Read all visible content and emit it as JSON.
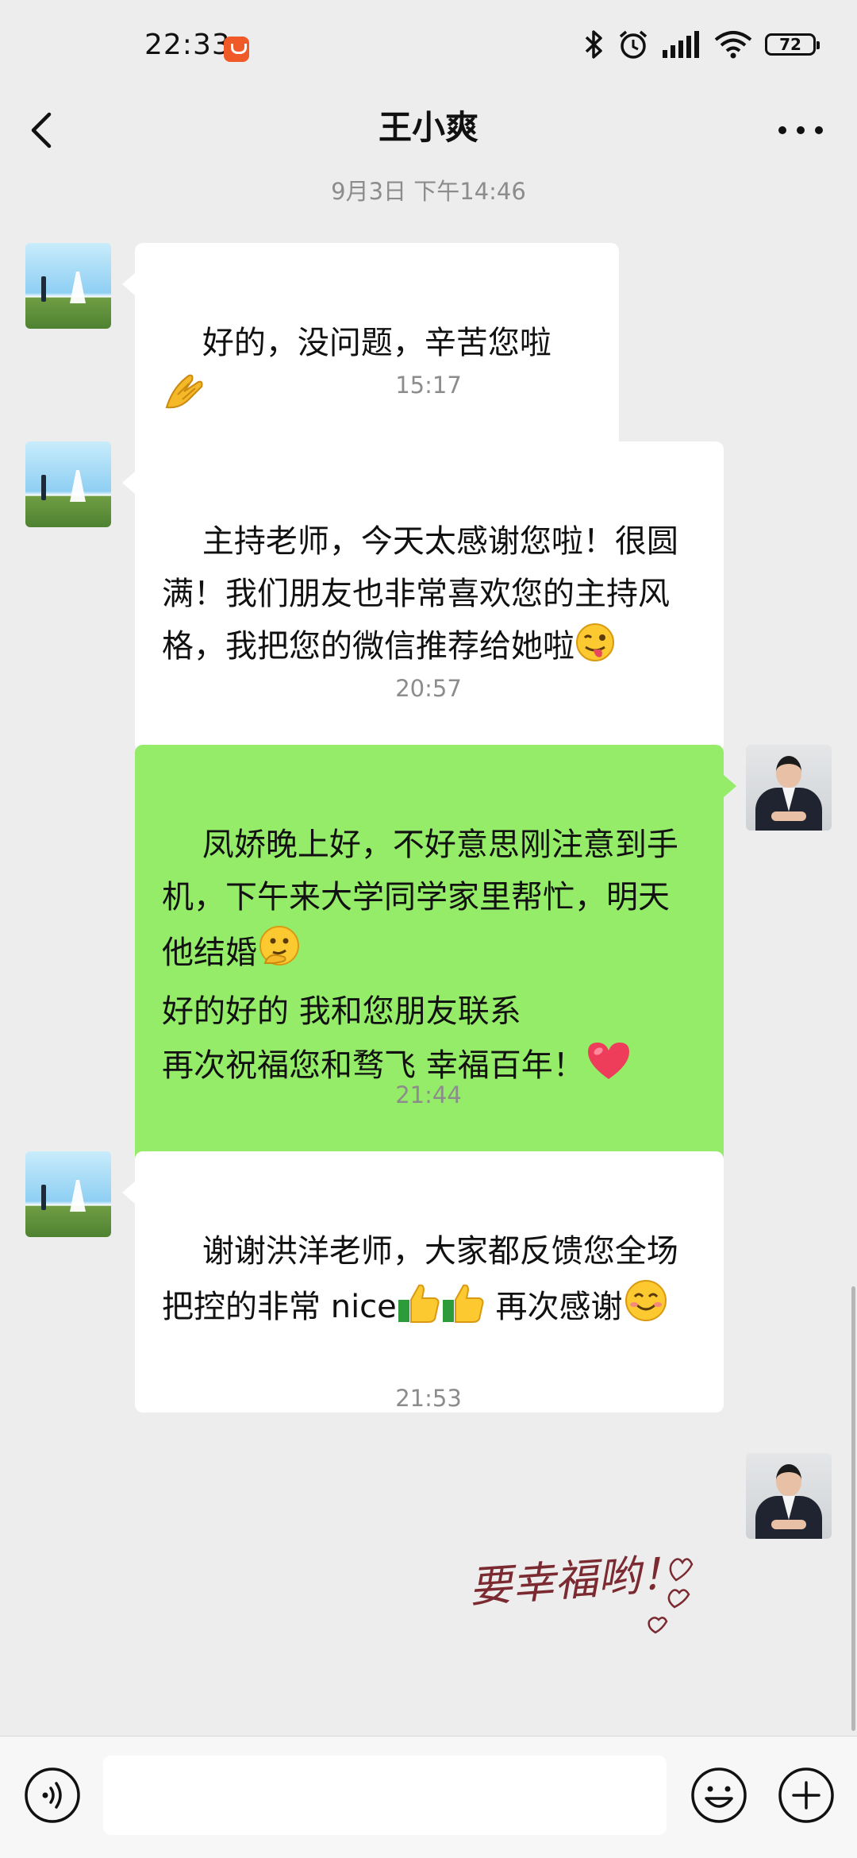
{
  "status_bar": {
    "time": "22:33",
    "battery": "72"
  },
  "header": {
    "title": "王小爽"
  },
  "messages": [
    {
      "type": "time",
      "text": "9月3日 下午14:46"
    },
    {
      "type": "msg",
      "from": "friend",
      "text": "好的，没问题，辛苦您啦",
      "emoji": "clasped-hands"
    },
    {
      "type": "time",
      "text": "15:17"
    },
    {
      "type": "msg",
      "from": "friend",
      "text": "主持老师，今天太感谢您啦！很圆满！我们朋友也非常喜欢您的主持风格，我把您的微信推荐给她啦",
      "emoji": "winking-tongue-face"
    },
    {
      "type": "time",
      "text": "20:57"
    },
    {
      "type": "msg",
      "from": "me",
      "line1": "凤娇晚上好，不好意思刚注意到手机，下午来大学同学家里帮忙，明天他结婚",
      "emoji1": "thinking-hand-face",
      "line2": "好的好的 我和您朋友联系",
      "line3": "再次祝福您和骛飞 幸福百年！",
      "emoji2": "red-heart"
    },
    {
      "type": "time",
      "text": "21:44"
    },
    {
      "type": "msg",
      "from": "friend",
      "text_a": "谢谢洪洋老师，大家都反馈您全场把控的非常 nice",
      "emoji_a": "thumbs-up",
      "text_b": " 再次感谢",
      "emoji_b": "smiling-face"
    },
    {
      "type": "time",
      "text": "21:53"
    },
    {
      "type": "sticker",
      "from": "me",
      "text": "要幸福哟！"
    }
  ],
  "input": {
    "placeholder": ""
  },
  "colors": {
    "chat_background": "#ededed",
    "incoming_bubble": "#ffffff",
    "outgoing_bubble": "#95ec69"
  }
}
